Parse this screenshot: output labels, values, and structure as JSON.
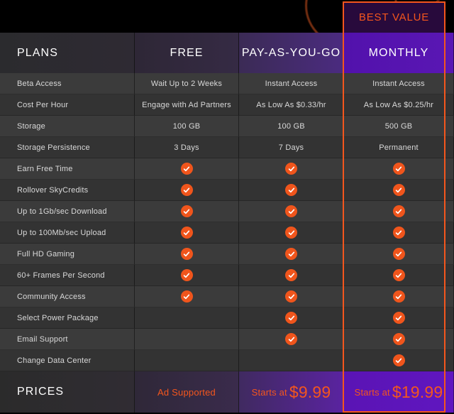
{
  "badge": {
    "best_value": "BEST VALUE"
  },
  "colors": {
    "accent_orange": "#f4561d",
    "check_orange": "#f0551c",
    "highlight_purple": "#5211ac",
    "banner_purple": "#280a3c"
  },
  "header": {
    "plans": "PLANS",
    "columns": [
      "FREE",
      "PAY-AS-YOU-GO",
      "MONTHLY"
    ]
  },
  "rows": [
    {
      "label": "Beta Access",
      "free": "Wait Up to 2 Weeks",
      "payg": "Instant Access",
      "monthly": "Instant Access"
    },
    {
      "label": "Cost Per Hour",
      "free": "Engage with Ad Partners",
      "payg": "As Low As $0.33/hr",
      "monthly": "As Low As $0.25/hr"
    },
    {
      "label": "Storage",
      "free": "100 GB",
      "payg": "100 GB",
      "monthly": "500 GB"
    },
    {
      "label": "Storage Persistence",
      "free": "3 Days",
      "payg": "7 Days",
      "monthly": "Permanent"
    },
    {
      "label": "Earn Free Time",
      "free": "check",
      "payg": "check",
      "monthly": "check"
    },
    {
      "label": "Rollover SkyCredits",
      "free": "check",
      "payg": "check",
      "monthly": "check"
    },
    {
      "label": "Up to 1Gb/sec Download",
      "free": "check",
      "payg": "check",
      "monthly": "check"
    },
    {
      "label": "Up to 100Mb/sec Upload",
      "free": "check",
      "payg": "check",
      "monthly": "check"
    },
    {
      "label": "Full HD Gaming",
      "free": "check",
      "payg": "check",
      "monthly": "check"
    },
    {
      "label": "60+ Frames Per Second",
      "free": "check",
      "payg": "check",
      "monthly": "check"
    },
    {
      "label": "Community Access",
      "free": "check",
      "payg": "check",
      "monthly": "check"
    },
    {
      "label": "Select Power Package",
      "free": "",
      "payg": "check",
      "monthly": "check"
    },
    {
      "label": "Email Support",
      "free": "",
      "payg": "check",
      "monthly": "check"
    },
    {
      "label": "Change Data Center",
      "free": "",
      "payg": "",
      "monthly": "check"
    }
  ],
  "prices": {
    "label": "PRICES",
    "free": {
      "text": "Ad Supported",
      "amount": ""
    },
    "payg": {
      "text": "Starts at",
      "amount": "$9.99"
    },
    "monthly": {
      "text": "Starts at",
      "amount": "$19.99"
    }
  }
}
